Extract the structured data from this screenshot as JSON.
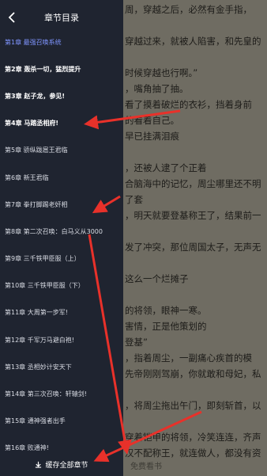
{
  "reader": {
    "lines": [
      "周，穿越之后，必然有金手指，",
      "",
      "穿越过来，就被人陷害，和先皇的",
      "",
      "时候穿越也行啊。”",
      "，嘴角抽了抽。",
      "看了摸着破烂的衣衫，挡着身前",
      "的看着自己。",
      "早已挂满泪痕",
      "",
      "，还被人逮了个正着",
      "合脑海中的记忆，周尘哪里还不明",
      "了套",
      "，明天就要登基称王了，结果前一",
      "",
      "发了冲突，那位周国太子，无声无",
      "",
      "这么一个烂摊子",
      "",
      "的将领，眼神一寒。",
      "害情，正是他策划的",
      "登基”",
      "，指着周尘，一副痛心疾首的模",
      "先帝刚刚驾崩，你就敢和母妃，私",
      "",
      "，将周尘拖出午门，即刻斩首，以",
      "",
      "穿着铠甲的将领，冷笑连连，齐声",
      "汉不配称王，就连做人，都没有资"
    ],
    "footer": "免费看书"
  },
  "drawer": {
    "title": "章节目录",
    "chapters": [
      {
        "label": "第1章 最强召唤系统",
        "style": "cur"
      },
      {
        "label": "第2章 轰杀一切，猛烈提升",
        "style": "bold"
      },
      {
        "label": "第3章 赵子龙，参见!",
        "style": "bold"
      },
      {
        "label": "第4章 马踏丞相府!",
        "style": "bold"
      },
      {
        "label": "第5章 骄纵跋扈王君临",
        "style": "dim"
      },
      {
        "label": "第6章 新王君临",
        "style": "dim"
      },
      {
        "label": "第7章 拳打脚踢老奸相",
        "style": "dim"
      },
      {
        "label": "第8章 第二次召唤：白马义从3000",
        "style": "dim"
      },
      {
        "label": "第9章 三千铁甲臣服（上）",
        "style": "dim"
      },
      {
        "label": "第10章 三千铁甲臣服（下）",
        "style": "dim"
      },
      {
        "label": "第11章 大周第一步军!",
        "style": "dim"
      },
      {
        "label": "第12章 千军万马避白袍!",
        "style": "dim"
      },
      {
        "label": "第13章 丞相妙计安天下",
        "style": "dim"
      },
      {
        "label": "第14章 第三次召唤：轩辕剑!",
        "style": "dim"
      },
      {
        "label": "第15章 通神强者出手",
        "style": "dim"
      },
      {
        "label": "第16章 败通神!",
        "style": "dim"
      }
    ],
    "save_all_label": "缓存全部章节"
  },
  "colors": {
    "drawer_bg": "#1f2430",
    "current_chapter": "#7f95ff",
    "annotation_arrow": "#e8312a"
  }
}
